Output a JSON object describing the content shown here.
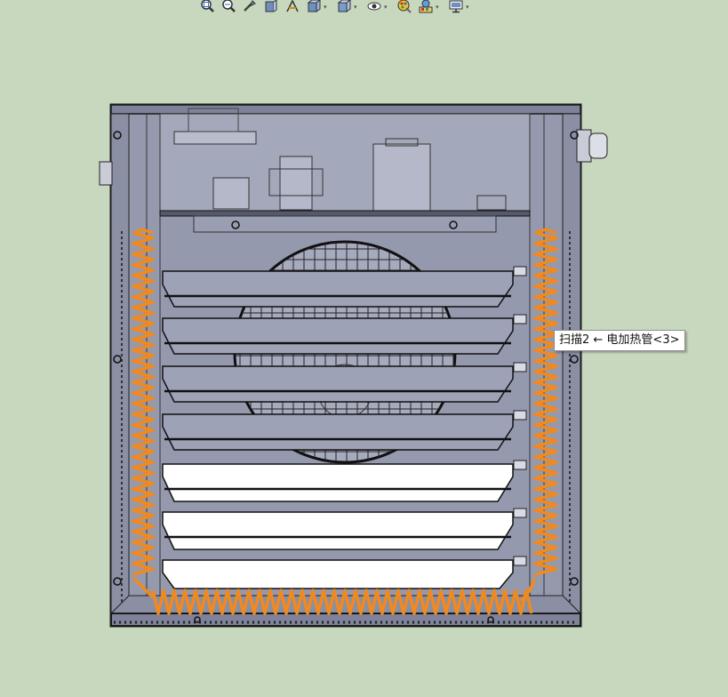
{
  "toolbar": {
    "buttons": [
      {
        "icon": "zoom-to-fit-icon"
      },
      {
        "icon": "zoom-to-area-icon"
      },
      {
        "icon": "previous-view-icon"
      },
      {
        "icon": "section-view-icon"
      },
      {
        "icon": "dynamic-annotation-icon"
      },
      {
        "icon": "view-orientation-icon",
        "has_dropdown": true
      },
      {
        "icon": "display-style-icon",
        "has_dropdown": true
      },
      {
        "icon": "hide-show-items-icon",
        "has_dropdown": true
      },
      {
        "icon": "edit-appearance-icon"
      },
      {
        "icon": "apply-scene-icon",
        "has_dropdown": true
      },
      {
        "icon": "view-settings-icon",
        "has_dropdown": true
      }
    ],
    "dropdown_glyph": "▾"
  },
  "tooltip": {
    "text": "扫描2 ← 电加热管<3>"
  },
  "colors": {
    "background": "#c8d8bf",
    "housing_fill": "#9499ad",
    "housing_stroke": "#1a1a1a",
    "heater_orange": "#f08a1e",
    "louver_white": "#ffffff"
  }
}
